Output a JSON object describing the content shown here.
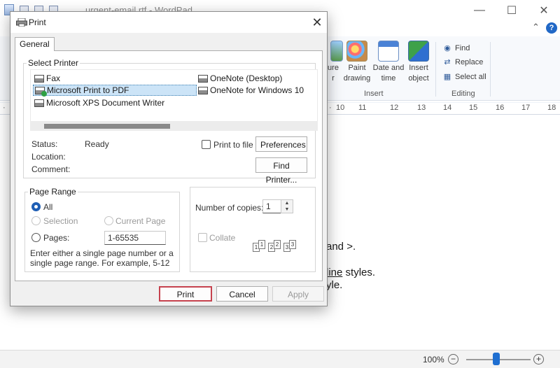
{
  "window": {
    "title": "urgent-email.rtf - WordPad"
  },
  "ribbon": {
    "buttons": [
      {
        "label": "ure",
        "label2": "r"
      },
      {
        "label": "Paint",
        "label2": "drawing"
      },
      {
        "label": "Date and",
        "label2": "time"
      },
      {
        "label": "Insert",
        "label2": "object"
      }
    ],
    "insert_group": "Insert",
    "editing_group": "Editing",
    "editing_items": [
      "Find",
      "Replace",
      "Select all"
    ]
  },
  "ruler": {
    "ticks": [
      "10",
      "11",
      "12",
      "13",
      "14",
      "15",
      "16",
      "17",
      "18"
    ]
  },
  "document": {
    "line1": "and >.",
    "line2a": "line",
    "line2b": " styles.",
    "line3": "yle."
  },
  "status": {
    "zoom": "100%",
    "zoom_level_percent": 100
  },
  "dialog": {
    "title": "Print",
    "tab": "General",
    "select_printer_label": "Select Printer",
    "printers": [
      {
        "name": "Fax",
        "selected": false
      },
      {
        "name": "Microsoft Print to PDF",
        "selected": true
      },
      {
        "name": "Microsoft XPS Document Writer",
        "selected": false
      },
      {
        "name": "OneNote (Desktop)",
        "selected": false
      },
      {
        "name": "OneNote for Windows 10",
        "selected": false
      }
    ],
    "status_label": "Status:",
    "status_value": "Ready",
    "location_label": "Location:",
    "comment_label": "Comment:",
    "print_to_file": "Print to file",
    "preferences": "Preferences",
    "find_printer": "Find Printer...",
    "page_range": {
      "legend": "Page Range",
      "all": "All",
      "selection": "Selection",
      "current_page": "Current Page",
      "pages": "Pages:",
      "pages_value": "1-65535",
      "hint": "Enter either a single page number or a single page range.  For example, 5-12"
    },
    "copies": {
      "label": "Number of copies:",
      "value": "1",
      "collate": "Collate",
      "collate_pages": [
        "1",
        "1",
        "2",
        "2",
        "3",
        "3"
      ]
    },
    "buttons": {
      "print": "Print",
      "cancel": "Cancel",
      "apply": "Apply"
    }
  }
}
